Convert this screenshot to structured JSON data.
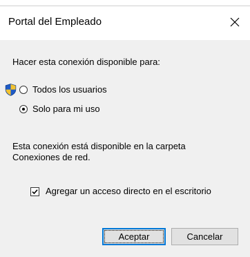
{
  "window": {
    "title": "Portal del Empleado",
    "top_fragment": "˙ ˙ ˙ ˙"
  },
  "dialog": {
    "prompt": "Hacer esta conexión disponible para:",
    "options": [
      {
        "label": "Todos los usuarios",
        "selected": false,
        "shield": true
      },
      {
        "label": "Solo para mi uso",
        "selected": true,
        "shield": false
      }
    ],
    "info_line1": "Esta conexión está disponible en la carpeta",
    "info_line2": "Conexiones de red.",
    "shortcut_label": "Agregar un acceso directo en el escritorio",
    "shortcut_checked": true
  },
  "buttons": {
    "ok_label": "Aceptar",
    "cancel_label": "Cancelar"
  },
  "icons": {
    "close": "close-icon",
    "shield": "uac-shield-icon",
    "check": "checkmark-icon"
  },
  "colors": {
    "dialog_bg": "#f0f0f0",
    "titlebar_bg": "#ffffff",
    "button_bg": "#e1e1e1",
    "focus_border": "#0078d7",
    "shield_blue": "#1f5bc6",
    "shield_yellow": "#f2c230"
  }
}
